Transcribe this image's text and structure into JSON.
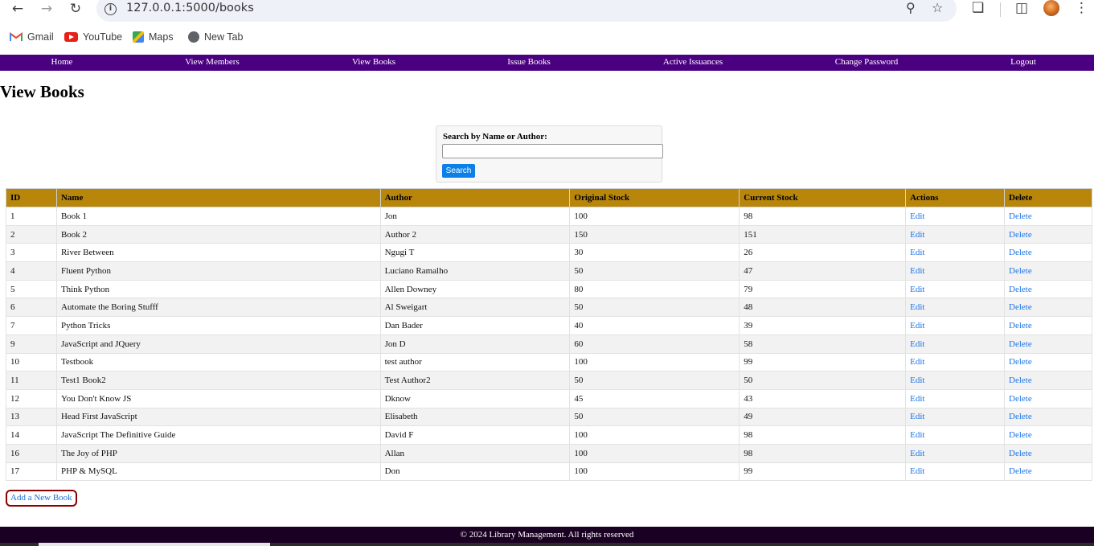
{
  "browser": {
    "url": "127.0.0.1:5000/books",
    "bookmarks": [
      {
        "label": "Gmail",
        "icon": "gmail-icon"
      },
      {
        "label": "YouTube",
        "icon": "youtube-icon"
      },
      {
        "label": "Maps",
        "icon": "maps-icon"
      },
      {
        "label": "New Tab",
        "icon": "globe-icon"
      }
    ]
  },
  "nav": {
    "items": [
      "Home",
      "View Members",
      "View Books",
      "Issue Books",
      "Active Issuances",
      "Change Password",
      "Logout"
    ],
    "background": "#4b0082"
  },
  "page": {
    "title": "View Books"
  },
  "search": {
    "label": "Search by Name or Author:",
    "button": "Search",
    "value": ""
  },
  "table": {
    "headers": [
      "ID",
      "Name",
      "Author",
      "Original Stock",
      "Current Stock",
      "Actions",
      "Delete"
    ],
    "header_color": "#b8860b",
    "edit_label": "Edit",
    "delete_label": "Delete",
    "rows": [
      {
        "id": "1",
        "name": "Book 1",
        "author": "Jon",
        "original": "100",
        "current": "98"
      },
      {
        "id": "2",
        "name": "Book 2",
        "author": "Author 2",
        "original": "150",
        "current": "151"
      },
      {
        "id": "3",
        "name": "River Between",
        "author": "Ngugi T",
        "original": "30",
        "current": "26"
      },
      {
        "id": "4",
        "name": "Fluent Python",
        "author": "Luciano Ramalho",
        "original": "50",
        "current": "47"
      },
      {
        "id": "5",
        "name": "Think Python",
        "author": "Allen Downey",
        "original": "80",
        "current": "79"
      },
      {
        "id": "6",
        "name": "Automate the Boring Stufff",
        "author": "Al Sweigart",
        "original": "50",
        "current": "48"
      },
      {
        "id": "7",
        "name": "Python Tricks",
        "author": "Dan Bader",
        "original": "40",
        "current": "39"
      },
      {
        "id": "9",
        "name": "JavaScript and JQuery",
        "author": "Jon D",
        "original": "60",
        "current": "58"
      },
      {
        "id": "10",
        "name": "Testbook",
        "author": "test author",
        "original": "100",
        "current": "99"
      },
      {
        "id": "11",
        "name": "Test1 Book2",
        "author": "Test Author2",
        "original": "50",
        "current": "50"
      },
      {
        "id": "12",
        "name": "You Don't Know JS",
        "author": "Dknow",
        "original": "45",
        "current": "43"
      },
      {
        "id": "13",
        "name": "Head First JavaScript",
        "author": "Elisabeth",
        "original": "50",
        "current": "49"
      },
      {
        "id": "14",
        "name": "JavaScript The Definitive Guide",
        "author": "David F",
        "original": "100",
        "current": "98"
      },
      {
        "id": "16",
        "name": "The Joy of PHP",
        "author": "Allan",
        "original": "100",
        "current": "98"
      },
      {
        "id": "17",
        "name": "PHP & MySQL",
        "author": "Don",
        "original": "100",
        "current": "99"
      }
    ]
  },
  "add_button": "Add a New Book",
  "footer": {
    "text": "© 2024 Library Management. All rights reserved"
  }
}
